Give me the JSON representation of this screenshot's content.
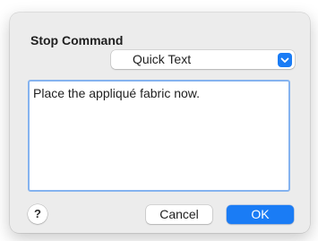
{
  "dialog": {
    "title": "Stop Command",
    "mode_select": {
      "selected": "Quick Text",
      "icon": "chevron-updown-icon"
    },
    "message": {
      "value": "Place the appliqué fabric now."
    },
    "help": {
      "label": "?",
      "icon": "help-icon"
    },
    "buttons": {
      "cancel_label": "Cancel",
      "ok_label": "OK"
    }
  },
  "colors": {
    "accent": "#1a7cf5",
    "dialog_bg": "#ececec",
    "focus_ring": "#85b3ef"
  }
}
